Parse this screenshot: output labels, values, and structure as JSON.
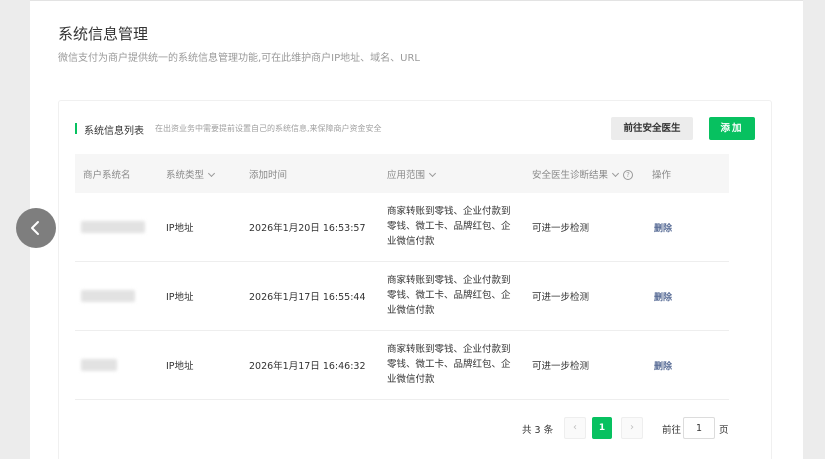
{
  "page": {
    "title": "系统信息管理",
    "description": "微信支付为商户提供统一的系统信息管理功能,可在此维护商户IP地址、域名、URL"
  },
  "card": {
    "title": "系统信息列表",
    "subtitle": "在出资业务中需要提前设置自己的系统信息,来保障商户资金安全",
    "doctor_button": "前往安全医生",
    "add_button": "添加"
  },
  "table": {
    "headers": {
      "name": "商户系统名",
      "type": "系统类型",
      "time": "添加时间",
      "scope": "应用范围",
      "diagnosis": "安全医生诊断结果",
      "action": "操作"
    },
    "help_icon": "?",
    "rows": [
      {
        "name": "(已模糊)",
        "type": "IP地址",
        "time": "2026年1月20日 16:53:57",
        "scope": "商家转账到零钱、企业付款到零钱、微工卡、品牌红包、企业微信付款",
        "diagnosis": "可进一步检测",
        "action": "删除"
      },
      {
        "name": "(已模糊)",
        "type": "IP地址",
        "time": "2026年1月17日 16:55:44",
        "scope": "商家转账到零钱、企业付款到零钱、微工卡、品牌红包、企业微信付款",
        "diagnosis": "可进一步检测",
        "action": "删除"
      },
      {
        "name": "(已模糊)",
        "type": "IP地址",
        "time": "2026年1月17日 16:46:32",
        "scope": "商家转账到零钱、企业付款到零钱、微工卡、品牌红包、企业微信付款",
        "diagnosis": "可进一步检测",
        "action": "删除"
      }
    ]
  },
  "pagination": {
    "total": "共 3 条",
    "prev": "‹",
    "current": "1",
    "next": "›",
    "goto_label": "前往",
    "goto_value": "1",
    "unit": "页"
  },
  "colors": {
    "accent": "#07c160",
    "link": "#576b95"
  },
  "icons": {
    "back": "back-arrow-icon",
    "help": "question-circle-icon",
    "sort": "chevron-down-icon"
  }
}
